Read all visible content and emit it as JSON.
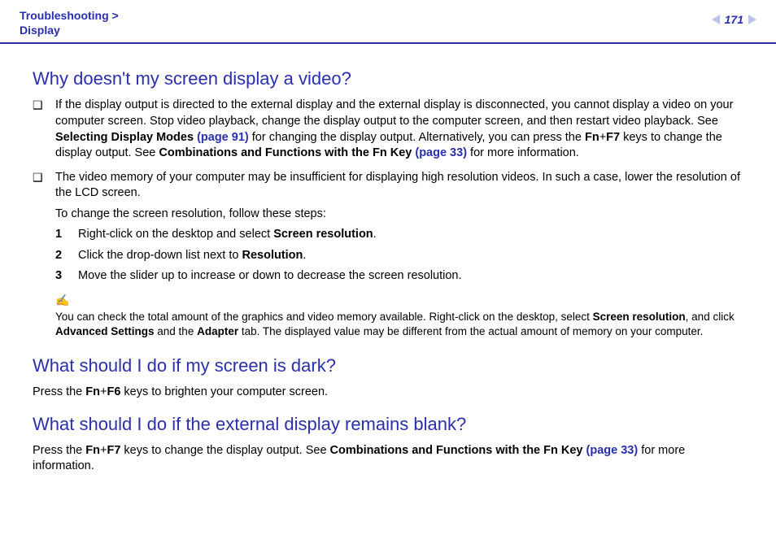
{
  "breadcrumb": {
    "section": "Troubleshooting",
    "sep": ">",
    "page": "Display"
  },
  "pagenav": {
    "number": "171"
  },
  "q1": {
    "title": "Why doesn't my screen display a video?",
    "item1": {
      "pre": "If the display output is directed to the external display and the external display is disconnected, you cannot display a video on your computer screen. Stop video playback, change the display output to the computer screen, and then restart video playback. See ",
      "ref1": "Selecting Display Modes ",
      "ref1page": "(page 91)",
      "mid1": " for changing the display output. Alternatively, you can press the ",
      "keys": "Fn",
      "plus": "+",
      "keys2": "F7",
      "mid2": " keys to change the display output. See ",
      "ref2": "Combinations and Functions with the Fn Key ",
      "ref2page": "(page 33)",
      "post": " for more information."
    },
    "item2": {
      "para1": "The video memory of your computer may be insufficient for displaying high resolution videos. In such a case, lower the resolution of the LCD screen.",
      "para2": "To change the screen resolution, follow these steps:",
      "step1_pre": "Right-click on the desktop and select ",
      "step1_bold": "Screen resolution",
      "step1_post": ".",
      "step2_pre": "Click the drop-down list next to ",
      "step2_bold": "Resolution",
      "step2_post": ".",
      "step3": "Move the slider up to increase or down to decrease the screen resolution.",
      "note_icon": "✍",
      "note_pre": "You can check the total amount of the graphics and video memory available. Right-click on the desktop, select ",
      "note_b1": "Screen resolution",
      "note_mid1": ", and click ",
      "note_b2": "Advanced Settings",
      "note_mid2": " and the ",
      "note_b3": "Adapter",
      "note_post": " tab. The displayed value may be different from the actual amount of memory on your computer."
    }
  },
  "q2": {
    "title": "What should I do if my screen is dark?",
    "pre": "Press the ",
    "k1": "Fn",
    "plus": "+",
    "k2": "F6",
    "post": " keys to brighten your computer screen."
  },
  "q3": {
    "title": "What should I do if the external display remains blank?",
    "pre": "Press the ",
    "k1": "Fn",
    "plus": "+",
    "k2": "F7",
    "mid": " keys to change the display output. See ",
    "ref": "Combinations and Functions with the Fn Key ",
    "refpage": "(page 33)",
    "post": " for more information."
  }
}
